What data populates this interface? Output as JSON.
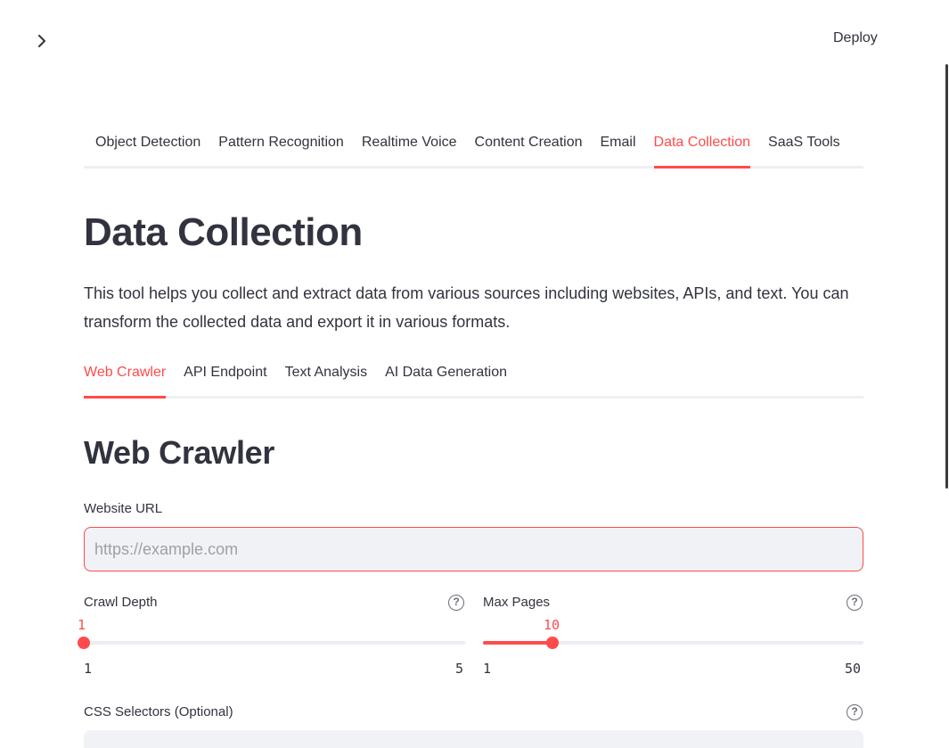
{
  "header": {
    "deploy_label": "Deploy"
  },
  "main_tabs": [
    {
      "label": "Object Detection",
      "active": false
    },
    {
      "label": "Pattern Recognition",
      "active": false
    },
    {
      "label": "Realtime Voice",
      "active": false
    },
    {
      "label": "Content Creation",
      "active": false
    },
    {
      "label": "Email",
      "active": false
    },
    {
      "label": "Data Collection",
      "active": true
    },
    {
      "label": "SaaS Tools",
      "active": false
    }
  ],
  "page": {
    "title": "Data Collection",
    "description": "This tool helps you collect and extract data from various sources including websites, APIs, and text. You can transform the collected data and export it in various formats."
  },
  "sub_tabs": [
    {
      "label": "Web Crawler",
      "active": true
    },
    {
      "label": "API Endpoint",
      "active": false
    },
    {
      "label": "Text Analysis",
      "active": false
    },
    {
      "label": "AI Data Generation",
      "active": false
    }
  ],
  "web_crawler": {
    "section_title": "Web Crawler",
    "url_label": "Website URL",
    "url_placeholder": "https://example.com",
    "url_value": "",
    "crawl_depth": {
      "label": "Crawl Depth",
      "value": "1",
      "min": "1",
      "max": "5",
      "help": "?"
    },
    "max_pages": {
      "label": "Max Pages",
      "value": "10",
      "min": "1",
      "max": "50",
      "help": "?"
    },
    "css_selectors": {
      "label": "CSS Selectors (Optional)",
      "help": "?"
    }
  },
  "colors": {
    "accent": "#ff4b4b",
    "text": "#31333f",
    "input_bg": "#f0f2f6",
    "track": "#eceef3"
  },
  "icons": {
    "expand_sidebar": "chevron-right-icon",
    "help": "help-circle-icon"
  }
}
